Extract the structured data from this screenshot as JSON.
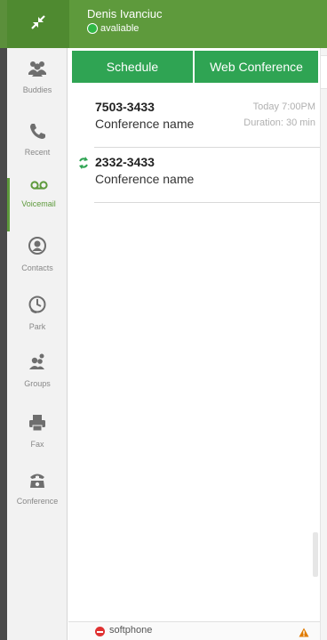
{
  "header": {
    "user_name": "Denis Ivanciuc",
    "status": "avaliable",
    "status_color": "#2fb845",
    "accent_color": "#5e9a3c",
    "collapse_icon": "collapse-arrows-icon"
  },
  "sidebar": {
    "items": [
      {
        "label": "Buddies",
        "icon": "buddies-icon",
        "active": false
      },
      {
        "label": "Recent",
        "icon": "phone-icon",
        "active": false
      },
      {
        "label": "Voicemail",
        "icon": "voicemail-icon",
        "active": true
      },
      {
        "label": "Contacts",
        "icon": "contacts-icon",
        "active": false
      },
      {
        "label": "Park",
        "icon": "park-clock-icon",
        "active": false
      },
      {
        "label": "Groups",
        "icon": "groups-icon",
        "active": false
      },
      {
        "label": "Fax",
        "icon": "fax-icon",
        "active": false
      },
      {
        "label": "Conference",
        "icon": "conference-phone-icon",
        "active": false
      }
    ]
  },
  "tabs": {
    "schedule": "Schedule",
    "web_conference": "Web Conference",
    "tab_color": "#2fa453"
  },
  "conferences": [
    {
      "number": "7503-3433",
      "name": "Conference name",
      "time": "Today 7:00PM",
      "duration": "Duration: 30 min",
      "recurring": false
    },
    {
      "number": "2332-3433",
      "name": "Conference name",
      "time": "",
      "duration": "",
      "recurring": true
    }
  ],
  "footer": {
    "softphone_label": "softphone",
    "softphone_status_color": "#e03131",
    "warning_color": "#e07b00"
  }
}
